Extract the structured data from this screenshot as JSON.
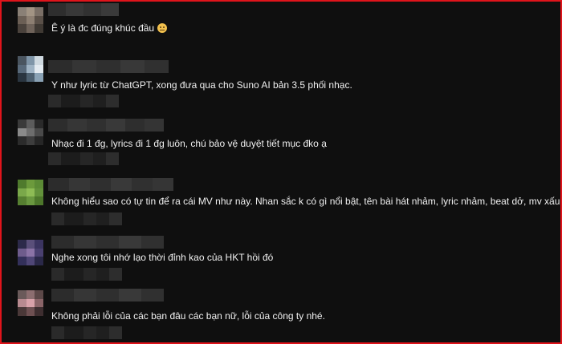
{
  "comments": [
    {
      "text": "Ê ý là đc đúng khúc đầu",
      "has_emoji": true,
      "emoji": "pensive-face"
    },
    {
      "text": "Y như lyric từ ChatGPT, xong đưa qua cho Suno AI bản 3.5 phối nhạc.",
      "has_emoji": false
    },
    {
      "text": "Nhạc đi 1 đg, lyrics đi 1 đg luôn, chú bảo vệ duyệt tiết mục đko ạ",
      "has_emoji": false
    },
    {
      "text": "Không hiểu sao có tự tin để ra cái MV như này. Nhan sắc k có gì nổi bật, tên bài hát nhảm, lyric nhảm, beat dở, mv xấu, nhảy hời hợt.",
      "has_emoji": false
    },
    {
      "text": "Nghe xong tôi nhớ lạo thời đỉnh kao của HKT hồi đó",
      "has_emoji": false
    },
    {
      "text": "Không phải lỗi của các bạn đâu các bạn nữ, lỗi của công ty nhé.",
      "has_emoji": false
    }
  ],
  "colors": {
    "frame_border": "#e0141b",
    "background": "#0f0f0f",
    "comment_text": "#f1f1f1",
    "avatars": [
      [
        "#8a8076",
        "#a29484",
        "#7a6f66",
        "#6b5f55",
        "#8d7f72",
        "#5a5048",
        "#4a423c",
        "#6f635a",
        "#3f3933"
      ],
      [
        "#4a5560",
        "#7f95a8",
        "#cfd9e0",
        "#58697a",
        "#9fb3c4",
        "#e3eaf0",
        "#2a3540",
        "#4d6070",
        "#8aa2b5"
      ],
      [
        "#3a3a3a",
        "#5c5c5c",
        "#2a2a2a",
        "#8a8a8a",
        "#6d6d6d",
        "#4a4a4a",
        "#2b2b2b",
        "#3d3d3d",
        "#262626"
      ],
      [
        "#4f7a2d",
        "#6c9a3c",
        "#5b8a35",
        "#7aa84a",
        "#8ebc55",
        "#63923b",
        "#567f31",
        "#6a9840",
        "#4d772b"
      ],
      [
        "#2c2a4a",
        "#5a4f7a",
        "#3b3460",
        "#6e5c8c",
        "#8b73a6",
        "#4a4070",
        "#33305a",
        "#4f4676",
        "#2a2848"
      ],
      [
        "#6a5a5a",
        "#8c6e70",
        "#5c4848",
        "#b88a90",
        "#d9a2aa",
        "#8a6468",
        "#4a3838",
        "#6e5052",
        "#3e2e30"
      ]
    ]
  }
}
